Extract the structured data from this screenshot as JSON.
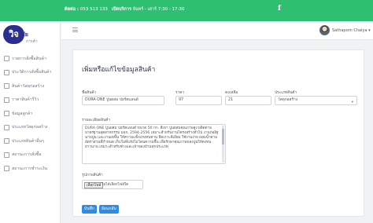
{
  "topbar": {
    "phone_label": "ติดต่อ :",
    "phone": "053 513 133",
    "hours_label": "เปิดบริการ",
    "hours": "จันทร์ - เสาร์ 7:30 - 17:30",
    "social_icon": "facebook-icon"
  },
  "logo": {
    "mark": "วิจ",
    "name": "ชัย",
    "sub": "การค้า"
  },
  "sidebar": {
    "items": [
      {
        "label": "รายการสั่งซื้อสินค้า",
        "icon": "cart-icon"
      },
      {
        "label": "ประวัติการสั่งซื้อสินค้า",
        "icon": "history-icon"
      },
      {
        "label": "สินค้าวัสดุก่อสร้าง",
        "icon": "tools-icon"
      },
      {
        "label": "ราคาสินค้ารีวิว",
        "icon": "tag-icon"
      },
      {
        "label": "ข้อมูลลูกค้า",
        "icon": "user-icon"
      },
      {
        "label": "ประเภทวัสดุก่อสร้าง",
        "icon": "category-icon"
      },
      {
        "label": "ประเภทสินค้าอื่นๆ",
        "icon": "list-icon"
      },
      {
        "label": "สถานะการสั่งซื้อ",
        "icon": "status-icon"
      },
      {
        "label": "สถานะการชำระเงิน",
        "icon": "payment-icon"
      }
    ]
  },
  "header": {
    "user_name": "Sathaporn Chaiya ▾"
  },
  "form": {
    "title": "เพิ่มหรือแก้ไขข้อมูลสินค้า",
    "name_label": "ชื่อสินค้า",
    "name_value": "DURA ONE ปูนผสม ปอร์ตแลนด์",
    "price_label": "ราคา",
    "price_value": "97",
    "qty_label": "คงเหลือ",
    "qty_value": "21",
    "category_label": "ประเภทสินค้า",
    "category_value": "วัสดุก่อสร้าง",
    "desc_label": "รายละเอียดสินค้า",
    "desc_value": "DURA ONE ปูนผสม ปอร์ตแลนด์ ขนาด 50 กก. สีเทา ปูนผสมคุณภาพสูง ผลิตตามมาตรฐานอุตสาหกรรม มอก. 2594-2556 เหมาะสำหรับงานโครงสร้างทั่วไป งานก่ออิฐ ฉาบปูน และงานเทพื้น ให้ความแข็งแรงทนทาน ยึดเกาะดีเยี่ยม ใช้งานง่าย ผสมน้ำตามอัตราส่วนที่กำหนด เก็บในที่แห้งไม่โดนความชื้น เพื่อรักษาคุณภาพของปูนให้คงทนยาวนาน เหมาะสำหรับช่างและเจ้าของบ้านทุกประเภท",
    "image_label": "รูปภาพสินค้า",
    "file_button": "เลือกไฟล์",
    "file_text": "ไม่ได้เลือกไฟล์ใด",
    "save_button": "บันทึก",
    "cancel_button": "ย้อนกลับ"
  }
}
